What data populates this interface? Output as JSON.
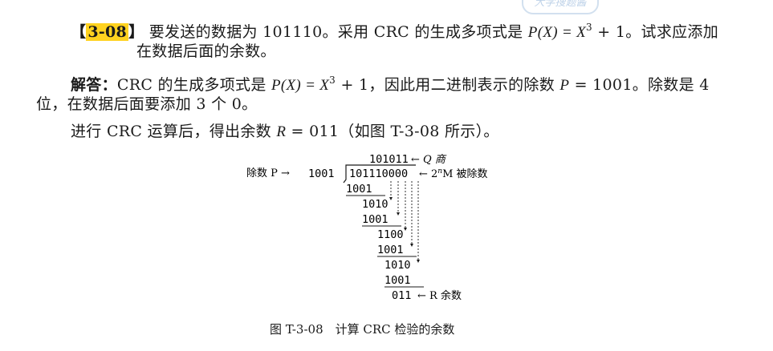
{
  "problem": {
    "tag_open": "【",
    "tag_num": "3-08",
    "tag_close": "】",
    "line1_a": "要发送的数据为 101110。采用 CRC 的生成多项式是 ",
    "line1_poly": "P(X) = X",
    "line1_exp": "3",
    "line1_b": " + 1。试求应添加",
    "line2": "在数据后面的余数。"
  },
  "answer": {
    "label": "解答：",
    "line1_a": "CRC 的生成多项式是 ",
    "line1_poly": "P(X) = X",
    "line1_exp": "3",
    "line1_b": " + 1，因此用二进制表示的除数 ",
    "line1_p": "P",
    "line1_c": " = 1001。除数是 4",
    "line2": "位，在数据后面要添加 3 个 0。",
    "line3_a": "进行 CRC 运算后，得出余数 ",
    "line3_r": "R",
    "line3_b": " = 011（如图 T-3-08 所示）。"
  },
  "watermark": {
    "text": "大学搜题酱"
  },
  "figure": {
    "divisor_label": "除数 P →",
    "divisor": "1001",
    "quotient": "101011",
    "quotient_label": "← Q 商",
    "dividend": "101110000",
    "dividend_label_a": "← 2",
    "dividend_label_n": "n",
    "dividend_label_b": "M 被除数",
    "steps": [
      "1001",
      "1010",
      "1001",
      "1100",
      "1001",
      "1010",
      "1001"
    ],
    "remainder": "011",
    "remainder_label": "← R 余数",
    "caption": "图 T-3-08　计算 CRC 检验的余数"
  }
}
